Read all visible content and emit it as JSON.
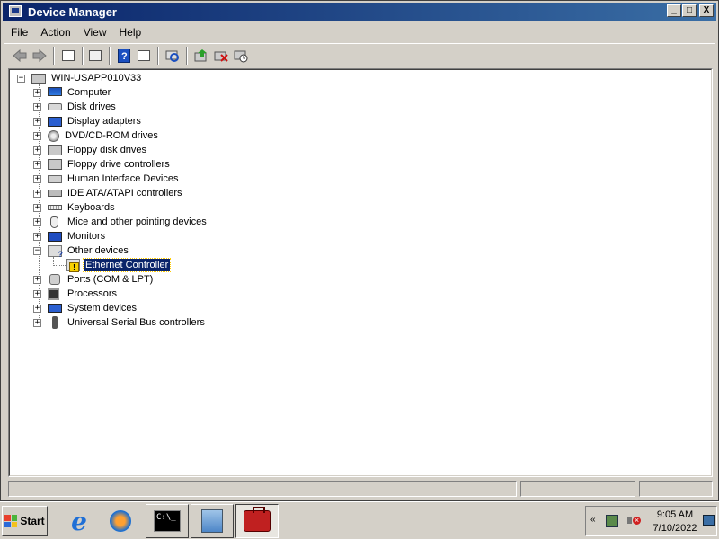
{
  "window": {
    "title": "Device Manager",
    "controls": {
      "minimize": "_",
      "maximize": "□",
      "close": "X"
    }
  },
  "menu": [
    "File",
    "Action",
    "View",
    "Help"
  ],
  "toolbar": {
    "buttons": [
      "back-icon",
      "forward-icon",
      "up-icon",
      "properties-icon",
      "help-icon",
      "show-hide-tree-icon",
      "scan-hardware-icon",
      "update-driver-icon",
      "uninstall-icon",
      "disable-icon"
    ]
  },
  "tree": {
    "root": "WIN-USAPP010V33",
    "items": [
      {
        "label": "Computer",
        "expanded": false,
        "icon": "computer-icon"
      },
      {
        "label": "Disk drives",
        "expanded": false,
        "icon": "disk-drive-icon"
      },
      {
        "label": "Display adapters",
        "expanded": false,
        "icon": "display-adapter-icon"
      },
      {
        "label": "DVD/CD-ROM drives",
        "expanded": false,
        "icon": "dvd-drive-icon"
      },
      {
        "label": "Floppy disk drives",
        "expanded": false,
        "icon": "floppy-disk-icon"
      },
      {
        "label": "Floppy drive controllers",
        "expanded": false,
        "icon": "floppy-controller-icon"
      },
      {
        "label": "Human Interface Devices",
        "expanded": false,
        "icon": "hid-icon"
      },
      {
        "label": "IDE ATA/ATAPI controllers",
        "expanded": false,
        "icon": "ide-controller-icon"
      },
      {
        "label": "Keyboards",
        "expanded": false,
        "icon": "keyboard-icon"
      },
      {
        "label": "Mice and other pointing devices",
        "expanded": false,
        "icon": "mouse-icon"
      },
      {
        "label": "Monitors",
        "expanded": false,
        "icon": "monitor-icon"
      },
      {
        "label": "Other devices",
        "expanded": true,
        "icon": "other-devices-icon",
        "children": [
          {
            "label": "Ethernet Controller",
            "selected": true,
            "icon": "warning-device-icon"
          }
        ]
      },
      {
        "label": "Ports (COM & LPT)",
        "expanded": false,
        "icon": "port-icon"
      },
      {
        "label": "Processors",
        "expanded": false,
        "icon": "processor-icon"
      },
      {
        "label": "System devices",
        "expanded": false,
        "icon": "system-device-icon"
      },
      {
        "label": "Universal Serial Bus controllers",
        "expanded": false,
        "icon": "usb-icon"
      }
    ]
  },
  "taskbar": {
    "start_label": "Start",
    "cmd_text": "C:\\_",
    "clock_time": "9:05 AM",
    "clock_date": "7/10/2022",
    "tray_chevron": "«"
  }
}
